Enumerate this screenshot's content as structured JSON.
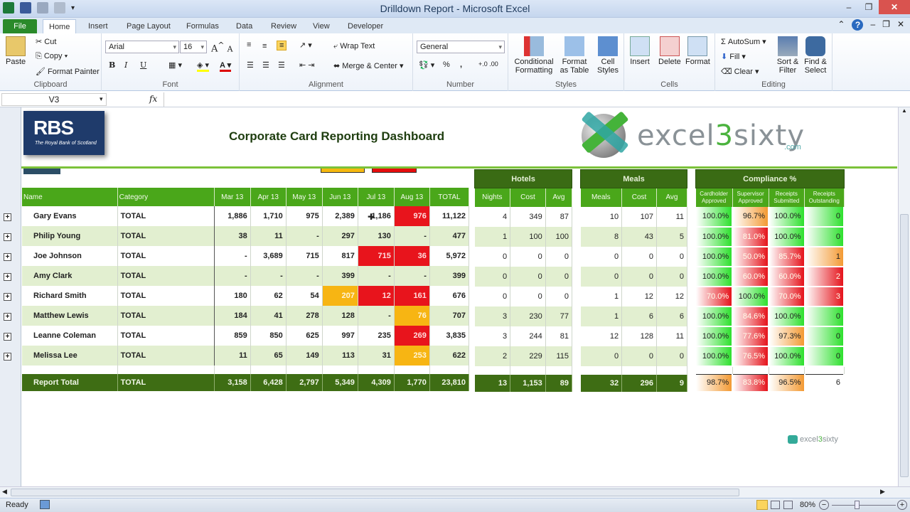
{
  "window": {
    "title": "Drilldown Report  -  Microsoft Excel"
  },
  "tabs": [
    "File",
    "Home",
    "Insert",
    "Page Layout",
    "Formulas",
    "Data",
    "Review",
    "View",
    "Developer"
  ],
  "ribbon": {
    "clipboard": {
      "label": "Clipboard",
      "paste": "Paste",
      "cut": "Cut",
      "copy": "Copy",
      "format_painter": "Format Painter"
    },
    "font": {
      "label": "Font",
      "family": "Arial",
      "size": "16",
      "bold": "B",
      "italic": "I",
      "underline": "U"
    },
    "alignment": {
      "label": "Alignment",
      "wrap_text": "Wrap Text",
      "merge_center": "Merge & Center"
    },
    "number": {
      "label": "Number",
      "format": "General",
      "percent": "%",
      "comma": ","
    },
    "styles": {
      "label": "Styles",
      "conditional": "Conditional Formatting",
      "format_table": "Format as Table",
      "cell_styles": "Cell Styles"
    },
    "cells": {
      "label": "Cells",
      "insert": "Insert",
      "delete": "Delete",
      "format": "Format"
    },
    "editing": {
      "label": "Editing",
      "autosum": "AutoSum",
      "fill": "Fill",
      "clear": "Clear",
      "sort_filter": "Sort & Filter",
      "find_select": "Find & Select"
    }
  },
  "formula_bar": {
    "name_box": "V3",
    "fx": "fx",
    "value": ""
  },
  "dashboard": {
    "title": "Corporate Card Reporting Dashboard",
    "rbs_logo": "RBS",
    "rbs_tag": "The Royal Bank of Scotland",
    "brand_logo": "excel3sixty",
    "brand_com": ".com",
    "colors": {
      "header_dark": "#3a6b14",
      "header_light": "#4aa71a",
      "red": "#e8141c",
      "amber": "#f7b513",
      "band": "#e2efd0"
    }
  },
  "table": {
    "headers": [
      "Name",
      "Category",
      "Mar 13",
      "Apr 13",
      "May 13",
      "Jun 13",
      "Jul 13",
      "Aug 13",
      "TOTAL"
    ],
    "hotels_title": "Hotels",
    "hotels_headers": [
      "Nights",
      "Cost",
      "Avg"
    ],
    "meals_title": "Meals",
    "meals_headers": [
      "Meals",
      "Cost",
      "Avg"
    ],
    "compliance_title": "Compliance %",
    "compliance_headers": [
      "Cardholder Approved",
      "Supervisor Approved",
      "Receipts Submitted",
      "Receipts Outstanding"
    ],
    "rows": [
      {
        "name": "Gary Evans",
        "cat": "TOTAL",
        "m": [
          "1,886",
          "1,710",
          "975",
          "2,389",
          "1,186",
          "976"
        ],
        "total": "11,122",
        "hl": [
          "",
          "",
          "",
          "",
          "",
          "red"
        ],
        "hotels": [
          "4",
          "349",
          "87"
        ],
        "meals": [
          "10",
          "107",
          "11"
        ],
        "comp": [
          "100.0%",
          "96.7%",
          "100.0%",
          "0"
        ],
        "cc": [
          "g",
          "o",
          "g",
          "g"
        ]
      },
      {
        "name": "Philip Young",
        "cat": "TOTAL",
        "m": [
          "38",
          "11",
          "-",
          "297",
          "130",
          "-"
        ],
        "total": "477",
        "hl": [
          "",
          "",
          "",
          "",
          "",
          ""
        ],
        "hotels": [
          "1",
          "100",
          "100"
        ],
        "meals": [
          "8",
          "43",
          "5"
        ],
        "comp": [
          "100.0%",
          "81.0%",
          "100.0%",
          "0"
        ],
        "cc": [
          "g",
          "rr",
          "g",
          "g"
        ]
      },
      {
        "name": "Joe Johnson",
        "cat": "TOTAL",
        "m": [
          "-",
          "3,689",
          "715",
          "817",
          "715",
          "36"
        ],
        "total": "5,972",
        "hl": [
          "",
          "",
          "",
          "",
          "red",
          "red"
        ],
        "hotels": [
          "0",
          "0",
          "0"
        ],
        "meals": [
          "0",
          "0",
          "0"
        ],
        "comp": [
          "100.0%",
          "50.0%",
          "85.7%",
          "1"
        ],
        "cc": [
          "g",
          "rr",
          "rr",
          "o"
        ]
      },
      {
        "name": "Amy Clark",
        "cat": "TOTAL",
        "m": [
          "-",
          "-",
          "-",
          "399",
          "-",
          "-"
        ],
        "total": "399",
        "hl": [
          "",
          "",
          "",
          "",
          "",
          ""
        ],
        "hotels": [
          "0",
          "0",
          "0"
        ],
        "meals": [
          "0",
          "0",
          "0"
        ],
        "comp": [
          "100.0%",
          "60.0%",
          "60.0%",
          "2"
        ],
        "cc": [
          "g",
          "rr",
          "rr",
          "rr"
        ]
      },
      {
        "name": "Richard Smith",
        "cat": "TOTAL",
        "m": [
          "180",
          "62",
          "54",
          "207",
          "12",
          "161"
        ],
        "total": "676",
        "hl": [
          "",
          "",
          "",
          "amb",
          "red",
          "red"
        ],
        "hotels": [
          "0",
          "0",
          "0"
        ],
        "meals": [
          "1",
          "12",
          "12"
        ],
        "comp": [
          "70.0%",
          "100.0%",
          "70.0%",
          "3"
        ],
        "cc": [
          "rr",
          "g",
          "rr",
          "rr"
        ]
      },
      {
        "name": "Matthew Lewis",
        "cat": "TOTAL",
        "m": [
          "184",
          "41",
          "278",
          "128",
          "-",
          "76"
        ],
        "total": "707",
        "hl": [
          "",
          "",
          "",
          "",
          "",
          "amb"
        ],
        "hotels": [
          "3",
          "230",
          "77"
        ],
        "meals": [
          "1",
          "6",
          "6"
        ],
        "comp": [
          "100.0%",
          "84.6%",
          "100.0%",
          "0"
        ],
        "cc": [
          "g",
          "rr",
          "g",
          "g"
        ]
      },
      {
        "name": "Leanne Coleman",
        "cat": "TOTAL",
        "m": [
          "859",
          "850",
          "625",
          "997",
          "235",
          "269"
        ],
        "total": "3,835",
        "hl": [
          "",
          "",
          "",
          "",
          "",
          "red"
        ],
        "hotels": [
          "3",
          "244",
          "81"
        ],
        "meals": [
          "12",
          "128",
          "11"
        ],
        "comp": [
          "100.0%",
          "77.6%",
          "97.3%",
          "0"
        ],
        "cc": [
          "g",
          "rr",
          "o",
          "g"
        ]
      },
      {
        "name": "Melissa Lee",
        "cat": "TOTAL",
        "m": [
          "11",
          "65",
          "149",
          "113",
          "31",
          "253"
        ],
        "total": "622",
        "hl": [
          "",
          "",
          "",
          "",
          "",
          "amb"
        ],
        "hotels": [
          "2",
          "229",
          "115"
        ],
        "meals": [
          "0",
          "0",
          "0"
        ],
        "comp": [
          "100.0%",
          "76.5%",
          "100.0%",
          "0"
        ],
        "cc": [
          "g",
          "rr",
          "g",
          "g"
        ]
      }
    ],
    "total_row": {
      "name": "Report Total",
      "cat": "TOTAL",
      "m": [
        "3,158",
        "6,428",
        "2,797",
        "5,349",
        "4,309",
        "1,770"
      ],
      "total": "23,810",
      "hotels": [
        "13",
        "1,153",
        "89"
      ],
      "meals": [
        "32",
        "296",
        "9"
      ],
      "comp": [
        "98.7%",
        "83.8%",
        "96.5%",
        "6"
      ],
      "cc": [
        "o",
        "rr",
        "o",
        "w"
      ]
    }
  },
  "status": {
    "ready": "Ready",
    "zoom": "80%"
  }
}
